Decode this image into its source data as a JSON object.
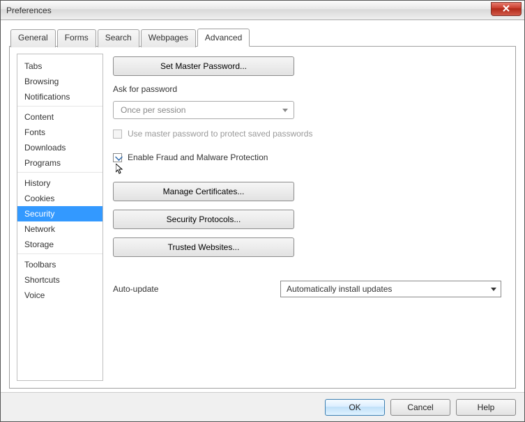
{
  "window": {
    "title": "Preferences"
  },
  "tabs": [
    {
      "label": "General"
    },
    {
      "label": "Forms"
    },
    {
      "label": "Search"
    },
    {
      "label": "Webpages"
    },
    {
      "label": "Advanced"
    }
  ],
  "sidebar": {
    "groups": [
      {
        "items": [
          {
            "label": "Tabs"
          },
          {
            "label": "Browsing"
          },
          {
            "label": "Notifications"
          }
        ]
      },
      {
        "items": [
          {
            "label": "Content"
          },
          {
            "label": "Fonts"
          },
          {
            "label": "Downloads"
          },
          {
            "label": "Programs"
          }
        ]
      },
      {
        "items": [
          {
            "label": "History"
          },
          {
            "label": "Cookies"
          },
          {
            "label": "Security"
          },
          {
            "label": "Network"
          },
          {
            "label": "Storage"
          }
        ]
      },
      {
        "items": [
          {
            "label": "Toolbars"
          },
          {
            "label": "Shortcuts"
          },
          {
            "label": "Voice"
          }
        ]
      }
    ],
    "selected": "Security"
  },
  "security": {
    "set_master_password": "Set Master Password...",
    "ask_for_password_label": "Ask for password",
    "ask_dropdown_value": "Once per session",
    "use_master_checkbox_label": "Use master password to protect saved passwords",
    "enable_fraud_label": "Enable Fraud and Malware Protection",
    "manage_certificates": "Manage Certificates...",
    "security_protocols": "Security Protocols...",
    "trusted_websites": "Trusted Websites...",
    "auto_update_label": "Auto-update",
    "auto_update_value": "Automatically install updates"
  },
  "footer": {
    "ok": "OK",
    "cancel": "Cancel",
    "help": "Help"
  }
}
